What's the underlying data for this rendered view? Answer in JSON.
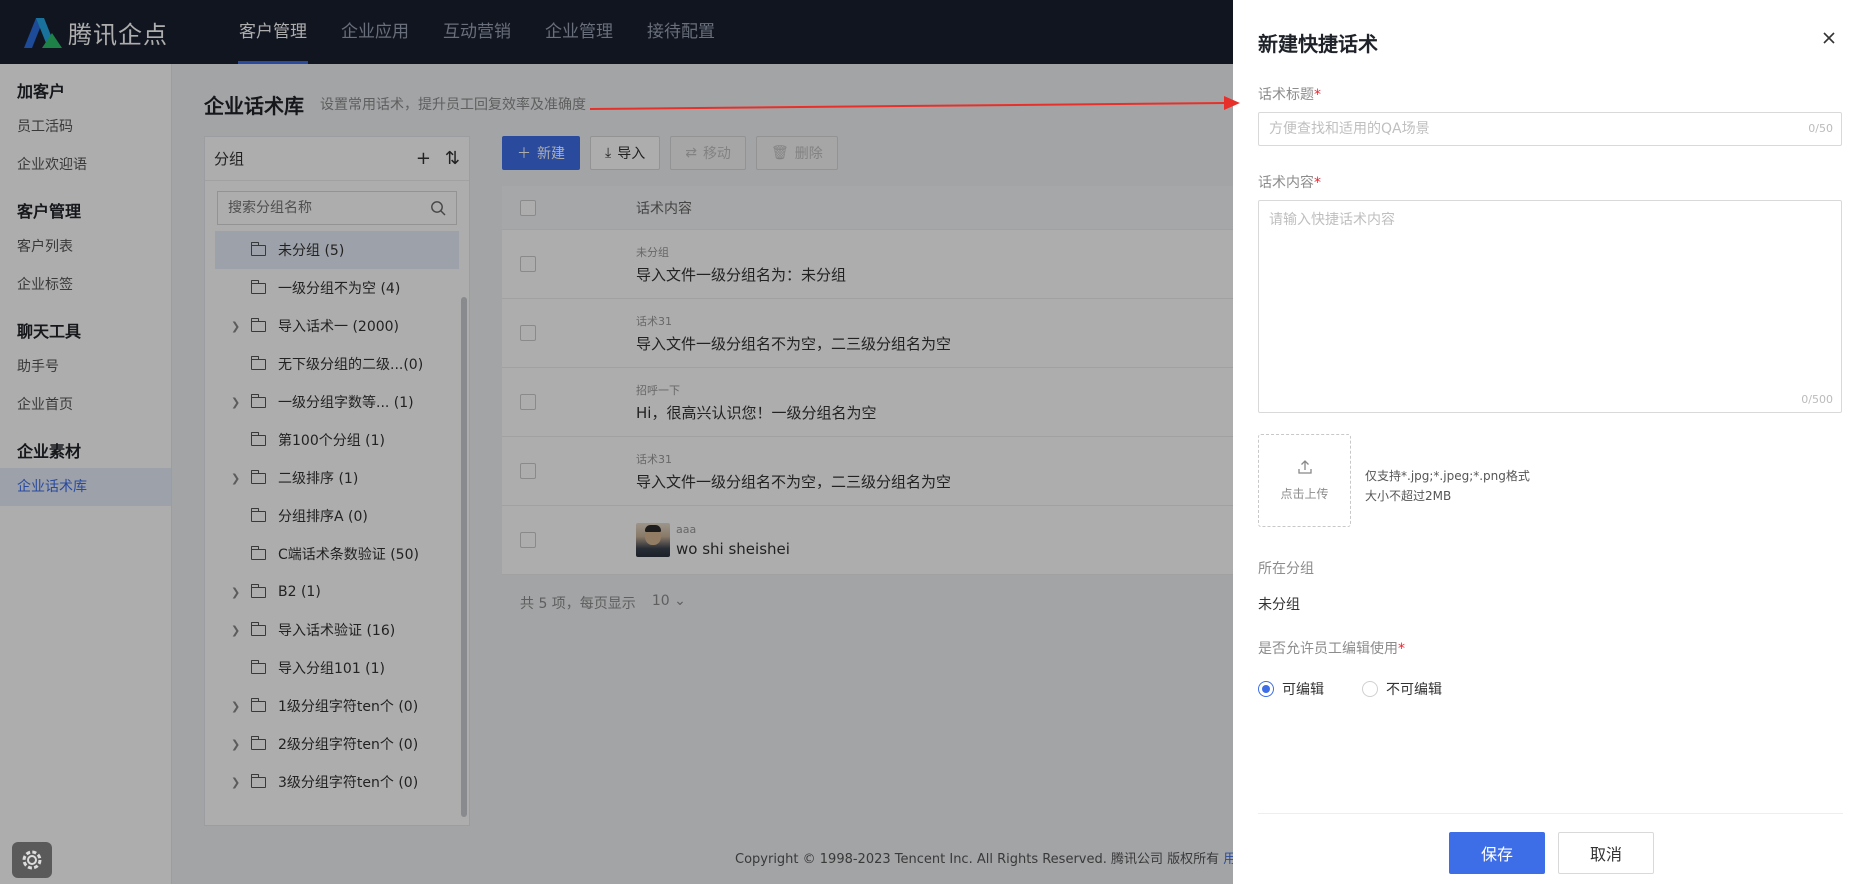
{
  "brand": {
    "name": "腾讯企点"
  },
  "topnav": {
    "items": [
      "客户管理",
      "企业应用",
      "互动营销",
      "企业管理",
      "接待配置"
    ]
  },
  "sidebar": {
    "groups": [
      {
        "title": "加客户",
        "items": [
          "员工活码",
          "企业欢迎语"
        ]
      },
      {
        "title": "客户管理",
        "items": [
          "客户列表",
          "企业标签"
        ]
      },
      {
        "title": "聊天工具",
        "items": [
          "助手号",
          "企业首页"
        ]
      },
      {
        "title": "企业素材",
        "items": [
          "企业话术库"
        ]
      }
    ]
  },
  "page": {
    "title": "企业话术库",
    "subtitle": "设置常用话术，提升员工回复效率及准确度"
  },
  "group_panel": {
    "title": "分组",
    "search_placeholder": "搜索分组名称",
    "items": [
      {
        "label": "未分组 (5)",
        "expandable": false,
        "selected": true
      },
      {
        "label": "一级分组不为空 (4)",
        "expandable": false
      },
      {
        "label": "导入话术一 (2000)",
        "expandable": true
      },
      {
        "label": "无下级分组的二级...(0)",
        "expandable": false
      },
      {
        "label": "一级分组字数等... (1)",
        "expandable": true
      },
      {
        "label": "第100个分组 (1)",
        "expandable": false
      },
      {
        "label": "二级排序 (1)",
        "expandable": true
      },
      {
        "label": "分组排序A (0)",
        "expandable": false
      },
      {
        "label": "C端话术条数验证 (50)",
        "expandable": false
      },
      {
        "label": "B2 (1)",
        "expandable": true
      },
      {
        "label": "导入话术验证 (16)",
        "expandable": true
      },
      {
        "label": "导入分组101 (1)",
        "expandable": false
      },
      {
        "label": "1级分组字符ten个 (0)",
        "expandable": true
      },
      {
        "label": "2级分组字符ten个 (0)",
        "expandable": true
      },
      {
        "label": "3级分组字符ten个 (0)",
        "expandable": true
      }
    ]
  },
  "toolbar": {
    "new": "新建",
    "import": "导入",
    "move": "移动",
    "delete": "删除"
  },
  "table": {
    "header": "话术内容",
    "rows": [
      {
        "sub": "未分组",
        "main": "导入文件一级分组名为：未分组"
      },
      {
        "sub": "话术31",
        "main": "导入文件一级分组名不为空，二三级分组名为空"
      },
      {
        "sub": "招呼一下",
        "main": "Hi，很高兴认识您！一级分组名为空"
      },
      {
        "sub": "话术31",
        "main": "导入文件一级分组名不为空，二三级分组名为空"
      },
      {
        "sub": "aaa",
        "main": "wo shi sheishei",
        "avatar": true
      }
    ]
  },
  "pager": {
    "summary": "共 5 项，每页显示",
    "page_size": "10"
  },
  "footer": {
    "copyright": "Copyright © 1998-2023 Tencent Inc. All Rights Reserved. 腾讯公司 版权所有",
    "link": "用户"
  },
  "drawer": {
    "title": "新建快捷话术",
    "title_label": "话术标题",
    "title_placeholder": "方便查找和适用的QA场景",
    "title_counter": "0/50",
    "content_label": "话术内容",
    "content_placeholder": "请输入快捷话术内容",
    "content_counter": "0/500",
    "upload_label": "点击上传",
    "upload_hint_1": "仅支持*.jpg;*.jpeg;*.png格式",
    "upload_hint_2": "大小不超过2MB",
    "group_label": "所在分组",
    "group_value": "未分组",
    "editable_label": "是否允许员工编辑使用",
    "radio_editable": "可编辑",
    "radio_not_editable": "不可编辑",
    "save": "保存",
    "cancel": "取消",
    "required_mark": "*"
  },
  "colors": {
    "accent": "#3d6ee8",
    "nav_bg": "#1a1f2e",
    "required": "#f5222d",
    "annotation_arrow": "#e8302a"
  }
}
